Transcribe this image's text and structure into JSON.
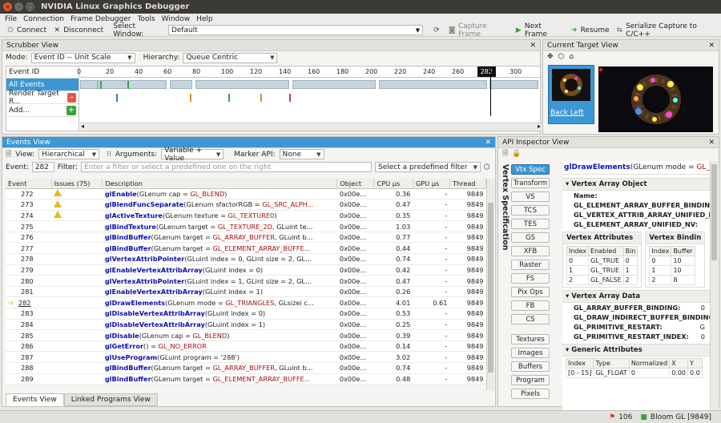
{
  "window": {
    "title": "NVIDIA Linux Graphics Debugger"
  },
  "menu": [
    "File",
    "Connection",
    "Frame Debugger",
    "Tools",
    "Window",
    "Help"
  ],
  "toolbar": {
    "connect": "Connect",
    "disconnect": "Disconnect",
    "select_window_label": "Select Window:",
    "select_window_value": "Default",
    "capture_frame": "Capture Frame",
    "next_frame": "Next Frame",
    "resume": "Resume",
    "serialize": "Serialize Capture to C/C++"
  },
  "scrubber": {
    "title": "Scrubber View",
    "mode_label": "Mode:",
    "mode_value": "Event ID -- Unit Scale",
    "hierarchy_label": "Hierarchy:",
    "hierarchy_value": "Queue Centric",
    "rows": [
      "Event ID",
      "All Events",
      "Render Target R...",
      "Add..."
    ],
    "ticks": [
      "0",
      "20",
      "40",
      "60",
      "80",
      "100",
      "120",
      "140",
      "160",
      "180",
      "200",
      "220",
      "240",
      "260",
      "282",
      "300"
    ],
    "cursor_event": "282"
  },
  "current_target": {
    "title": "Current Target View",
    "thumb_label": "Back Left"
  },
  "events": {
    "title": "Events View",
    "view_label": "View:",
    "view_value": "Hierarchical",
    "arguments_label": "Arguments:",
    "arguments_value": "Variable + Value",
    "marker_label": "Marker API:",
    "marker_value": "None",
    "event_label": "Event:",
    "event_value": "282",
    "filter_label": "Filter:",
    "filter_placeholder": "Enter a filter or select a predefined one on the right",
    "predefined": "Select a predefined filter",
    "columns": [
      "Event",
      "Issues (75)",
      "Description",
      "Object",
      "CPU µs",
      "GPU µs",
      "Thread"
    ],
    "rows": [
      {
        "id": "272",
        "warn": true,
        "fn": "glEnable",
        "args": "(GLenum cap = ",
        "enum": "GL_BLEND",
        "tail": ")",
        "obj": "0x00e...",
        "cpu": "0.36",
        "gpu": "-",
        "thread": "9849"
      },
      {
        "id": "273",
        "warn": true,
        "fn": "glBlendFuncSeparate",
        "args": "(GLenum sfactorRGB = ",
        "enum": "GL_SRC_ALPH...",
        "tail": "",
        "obj": "0x00e...",
        "cpu": "0.47",
        "gpu": "-",
        "thread": "9849"
      },
      {
        "id": "274",
        "warn": true,
        "fn": "glActiveTexture",
        "args": "(GLenum texture = ",
        "enum": "GL_TEXTURE0",
        "tail": ")",
        "obj": "0x00e...",
        "cpu": "0.35",
        "gpu": "-",
        "thread": "9849"
      },
      {
        "id": "275",
        "warn": false,
        "fn": "glBindTexture",
        "args": "(GLenum target = ",
        "enum": "GL_TEXTURE_2D",
        "tail": ", GLuint te...",
        "obj": "0x00e...",
        "cpu": "1.03",
        "gpu": "-",
        "thread": "9849"
      },
      {
        "id": "276",
        "warn": false,
        "fn": "glBindBuffer",
        "args": "(GLenum target = ",
        "enum": "GL_ARRAY_BUFFER",
        "tail": ", GLuint b...",
        "obj": "0x00e...",
        "cpu": "0.77",
        "gpu": "-",
        "thread": "9849"
      },
      {
        "id": "277",
        "warn": false,
        "fn": "glBindBuffer",
        "args": "(GLenum target = ",
        "enum": "GL_ELEMENT_ARRAY_BUFFE...",
        "tail": "",
        "obj": "0x00e...",
        "cpu": "0.44",
        "gpu": "-",
        "thread": "9849"
      },
      {
        "id": "278",
        "warn": false,
        "fn": "glVertexAttribPointer",
        "args": "(GLuint index = 0, GLint size = 2, GL...",
        "enum": "",
        "tail": "",
        "obj": "0x00e...",
        "cpu": "0.74",
        "gpu": "-",
        "thread": "9849"
      },
      {
        "id": "279",
        "warn": false,
        "fn": "glEnableVertexAttribArray",
        "args": "(GLuint index = 0)",
        "enum": "",
        "tail": "",
        "obj": "0x00e...",
        "cpu": "0.42",
        "gpu": "-",
        "thread": "9849"
      },
      {
        "id": "280",
        "warn": false,
        "fn": "glVertexAttribPointer",
        "args": "(GLuint index = 1, GLint size = 2, GL...",
        "enum": "",
        "tail": "",
        "obj": "0x00e...",
        "cpu": "0.47",
        "gpu": "-",
        "thread": "9849"
      },
      {
        "id": "281",
        "warn": false,
        "fn": "glEnableVertexAttribArray",
        "args": "(GLuint index = 1)",
        "enum": "",
        "tail": "",
        "obj": "0x00e...",
        "cpu": "0.26",
        "gpu": "-",
        "thread": "9849"
      },
      {
        "id": "282",
        "warn": false,
        "fn": "glDrawElements",
        "args": "(GLenum mode = ",
        "enum": "GL_TRIANGLES",
        "tail": ", GLsizei c...",
        "obj": "0x00e...",
        "cpu": "4.01",
        "gpu": "0.61",
        "thread": "9849",
        "current": true
      },
      {
        "id": "283",
        "warn": false,
        "fn": "glDisableVertexAttribArray",
        "args": "(GLuint index = 0)",
        "enum": "",
        "tail": "",
        "obj": "0x00e...",
        "cpu": "0.53",
        "gpu": "-",
        "thread": "9849"
      },
      {
        "id": "284",
        "warn": false,
        "fn": "glDisableVertexAttribArray",
        "args": "(GLuint index = 1)",
        "enum": "",
        "tail": "",
        "obj": "0x00e...",
        "cpu": "0.25",
        "gpu": "-",
        "thread": "9849"
      },
      {
        "id": "285",
        "warn": false,
        "fn": "glDisable",
        "args": "(GLenum cap = ",
        "enum": "GL_BLEND",
        "tail": ")",
        "obj": "0x00e...",
        "cpu": "0.39",
        "gpu": "-",
        "thread": "9849"
      },
      {
        "id": "286",
        "warn": false,
        "fn": "glGetError",
        "args": "() = ",
        "enum": "GL_NO_ERROR",
        "tail": "",
        "obj": "0x00e...",
        "cpu": "0.14",
        "gpu": "-",
        "thread": "9849"
      },
      {
        "id": "287",
        "warn": false,
        "fn": "glUseProgram",
        "args": "(GLuint program = '288')",
        "enum": "",
        "tail": "",
        "obj": "0x00e...",
        "cpu": "3.02",
        "gpu": "-",
        "thread": "9849"
      },
      {
        "id": "288",
        "warn": false,
        "fn": "glBindBuffer",
        "args": "(GLenum target = ",
        "enum": "GL_ARRAY_BUFFER",
        "tail": ", GLuint b...",
        "obj": "0x00e...",
        "cpu": "0.74",
        "gpu": "-",
        "thread": "9849"
      },
      {
        "id": "289",
        "warn": false,
        "fn": "glBindBuffer",
        "args": "(GLenum target = ",
        "enum": "GL_ELEMENT_ARRAY_BUFFE...",
        "tail": "",
        "obj": "0x00e...",
        "cpu": "0.48",
        "gpu": "-",
        "thread": "9849"
      }
    ],
    "tabs": [
      "Events View",
      "Linked Programs View"
    ]
  },
  "api": {
    "title": "API Inspector View",
    "vertical_label": "Vertex Specification",
    "stages": [
      "Vtx Spec",
      "Transform",
      "VS",
      "TCS",
      "TES",
      "GS",
      "XFB",
      "Raster",
      "FS",
      "Pix Ops",
      "FB",
      "CS"
    ],
    "extras": [
      "Textures",
      "Images",
      "Buffers",
      "Program",
      "Pixels"
    ],
    "header_fn": "glDrawElements",
    "header_args": "(GLenum mode = ",
    "header_enum": "GL_TR...",
    "vao_title": "Vertex Array Object",
    "vao_keys": [
      "Name:",
      "GL_ELEMENT_ARRAY_BUFFER_BINDING:",
      "GL_VERTEX_ATTRIB_ARRAY_UNIFIED_NV:",
      "GL_ELEMENT_ARRAY_UNIFIED_NV:"
    ],
    "va_attr_title": "Vertex Attributes",
    "va_bind_title": "Vertex Bindin",
    "va_cols": [
      "Index",
      "Enabled",
      "Bin"
    ],
    "va_rows": [
      [
        "0",
        "GL_TRUE",
        "0"
      ],
      [
        "1",
        "GL_TRUE",
        "1"
      ],
      [
        "2",
        "GL_FALSE",
        "2"
      ]
    ],
    "vb_cols": [
      "Index",
      "Buffer"
    ],
    "vb_rows": [
      [
        "0",
        "10"
      ],
      [
        "1",
        "10"
      ],
      [
        "2",
        "8"
      ]
    ],
    "vad_title": "Vertex Array Data",
    "vad_keys": [
      "GL_ARRAY_BUFFER_BINDING:",
      "GL_DRAW_INDIRECT_BUFFER_BINDING:",
      "GL_PRIMITIVE_RESTART:",
      "GL_PRIMITIVE_RESTART_INDEX:"
    ],
    "vad_vals": [
      "0",
      "(",
      "G",
      "0"
    ],
    "ga_title": "Generic Attributes",
    "ga_cols": [
      "Index",
      "Type",
      "Normalized",
      "X",
      "Y"
    ],
    "ga_row": [
      "[0 - 15]",
      "GL_FLOAT",
      "0",
      "0.00",
      "0.0"
    ]
  },
  "status": {
    "count": "106",
    "app": "Bloom GL [9849]"
  }
}
